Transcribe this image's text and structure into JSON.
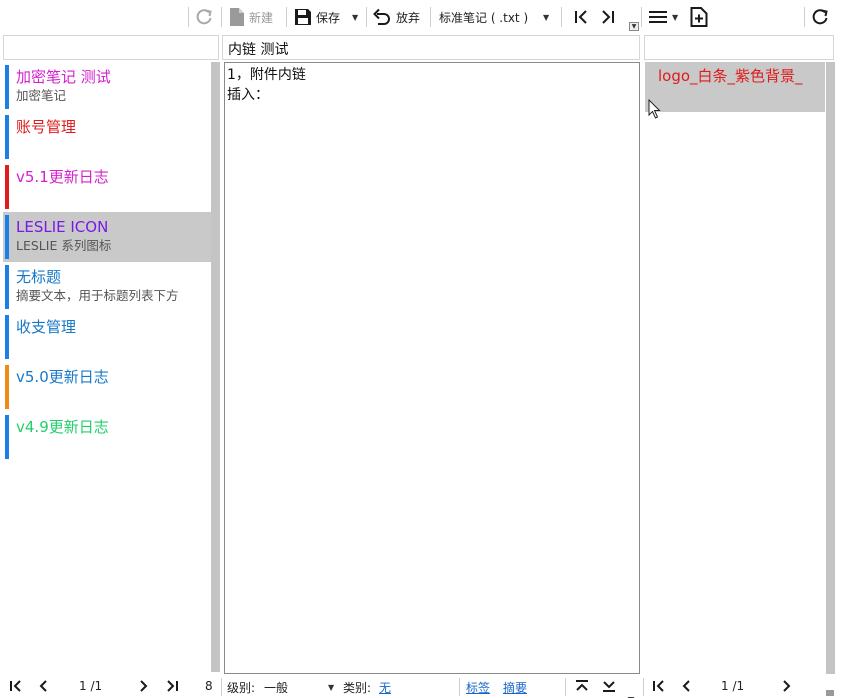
{
  "toolbar": {
    "new_label": "新建",
    "save_label": "保存",
    "discard_label": "放弃",
    "note_type": "标准笔记 ( .txt )"
  },
  "note_title": "内链 测试",
  "notes": [
    {
      "title": "加密笔记 测试",
      "summary": "加密笔记",
      "title_color": "#d61fd0",
      "bar_color": "#1e7ee8"
    },
    {
      "title": "账号管理",
      "summary": "",
      "title_color": "#e11b1b",
      "bar_color": "#1e7ee8"
    },
    {
      "title": "v5.1更新日志",
      "summary": "",
      "title_color": "#d61fd0",
      "bar_color": "#e11b1b"
    },
    {
      "title": "LESLIE ICON",
      "summary": "LESLIE  系列图标",
      "title_color": "#7a19e6",
      "bar_color": "#1e7ee8",
      "selected": true
    },
    {
      "title": "无标题",
      "summary": "摘要文本，用于标题列表下方",
      "title_color": "#1778c9",
      "bar_color": "#1e7ee8"
    },
    {
      "title": "收支管理",
      "summary": "",
      "title_color": "#1778c9",
      "bar_color": "#1e7ee8"
    },
    {
      "title": "v5.0更新日志",
      "summary": "",
      "title_color": "#1778c9",
      "bar_color": "#f08a16"
    },
    {
      "title": "v4.9更新日志",
      "summary": "",
      "title_color": "#1fd06a",
      "bar_color": "#1e7ee8"
    }
  ],
  "editor": {
    "lines": [
      "1，附件内链",
      "插入："
    ]
  },
  "attachments": [
    {
      "name": "logo_白条_紫色背景_"
    }
  ],
  "status": {
    "left_page": "1 /1",
    "note_count": "8",
    "level_label": "级别:",
    "level_value": "一般",
    "category_label": "类别:",
    "category_value": "无",
    "tags_label": "标签",
    "summary_label": "摘要",
    "right_page": "1 /1"
  }
}
